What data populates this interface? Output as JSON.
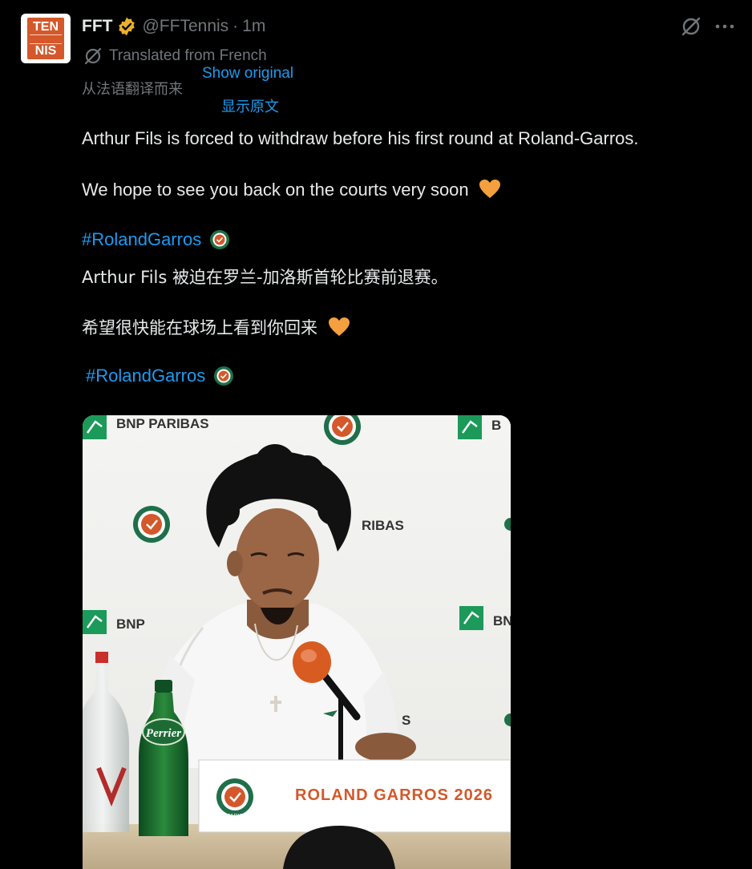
{
  "avatar": {
    "top_text": "TEN",
    "bottom_text": "NIS",
    "color": "#d4582a"
  },
  "header": {
    "name": "FFT",
    "handle": "@FFTennis",
    "separator": "·",
    "time": "1m",
    "verified_color": "#e8b02c"
  },
  "translation": {
    "label": "Translated from French",
    "label_zh": "从法语翻译而来",
    "show_original": "Show original",
    "show_original_zh": "显示原文"
  },
  "body": {
    "line1": "Arthur Fils is forced to withdraw before his first round at Roland-Garros.",
    "line2": "We hope to see you back on the courts very soon",
    "hashtag1": "#RolandGarros",
    "line1_zh": "Arthur Fils 被迫在罗兰-加洛斯首轮比赛前退赛。",
    "line2_zh": "希望很快能在球场上看到你回来",
    "hashtag2": "#RolandGarros"
  },
  "photo": {
    "sponsor": "BNP PARIBAS",
    "sponsor_partial": "RIBAS",
    "sponsor_short": "BNP",
    "sponsor_left": "B",
    "sponsor_right": "BN",
    "nameplate": "ROLAND GARROS 2026",
    "bottle_brand": "Perrier",
    "plate_logo_text": "PARIS",
    "partial_text": "S"
  },
  "colors": {
    "background": "#000000",
    "text": "#e7e9ea",
    "secondary": "#71767b",
    "link": "#1d9bf0",
    "heart": "#f4a03e",
    "rg_green": "#1f6f4a",
    "rg_orange": "#d4582a"
  }
}
